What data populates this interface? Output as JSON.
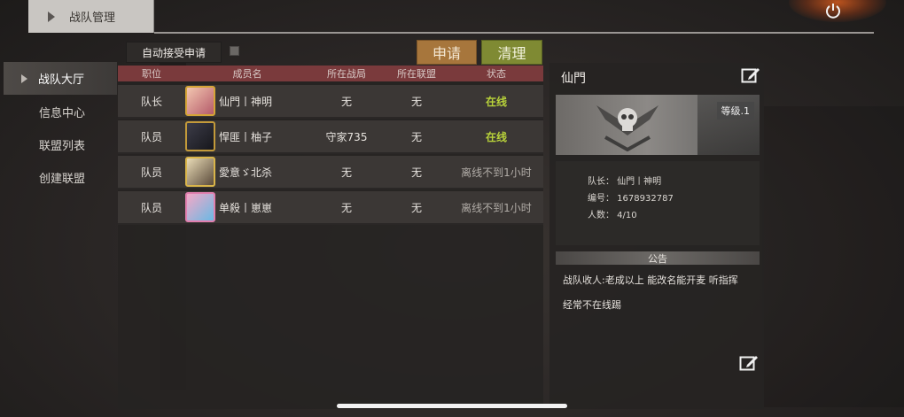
{
  "header": {
    "title": "战队管理",
    "power_icon": "power-icon"
  },
  "sidebar": {
    "items": [
      {
        "label": "战队大厅",
        "active": true
      },
      {
        "label": "信息中心",
        "active": false
      },
      {
        "label": "联盟列表",
        "active": false
      },
      {
        "label": "创建联盟",
        "active": false
      }
    ]
  },
  "controls": {
    "auto_accept_label": "自动接受申请",
    "apply_label": "申请",
    "clear_label": "清理"
  },
  "table": {
    "columns": [
      "职位",
      "成员名",
      "所在战局",
      "所在联盟",
      "状态"
    ],
    "rows": [
      {
        "role": "队长",
        "name": "仙門丨神明",
        "match": "无",
        "alliance": "无",
        "status": "在线",
        "online": true
      },
      {
        "role": "队员",
        "name": "悍匪丨柚子",
        "match": "守家735",
        "alliance": "无",
        "status": "在线",
        "online": true
      },
      {
        "role": "队员",
        "name": "愛意ゞ北杀",
        "match": "无",
        "alliance": "无",
        "status": "离线不到1小时",
        "online": false
      },
      {
        "role": "队员",
        "name": "单殺丨崽崽",
        "match": "无",
        "alliance": "无",
        "status": "离线不到1小时",
        "online": false
      }
    ]
  },
  "team_panel": {
    "name": "仙門",
    "level": "等级.1",
    "leader": "队长： 仙門丨神明",
    "id": "编号： 1678932787",
    "count": "人数： 4/10",
    "notice_title": "公告",
    "notice_line1": "战队收人:老成以上  能改名能开麦  听指挥",
    "notice_line2": "经常不在线踢"
  },
  "colors": {
    "online": "#b8d23a",
    "header_row": "#7a3a3c",
    "apply": "#a7763c",
    "clear": "#7f8a33"
  }
}
